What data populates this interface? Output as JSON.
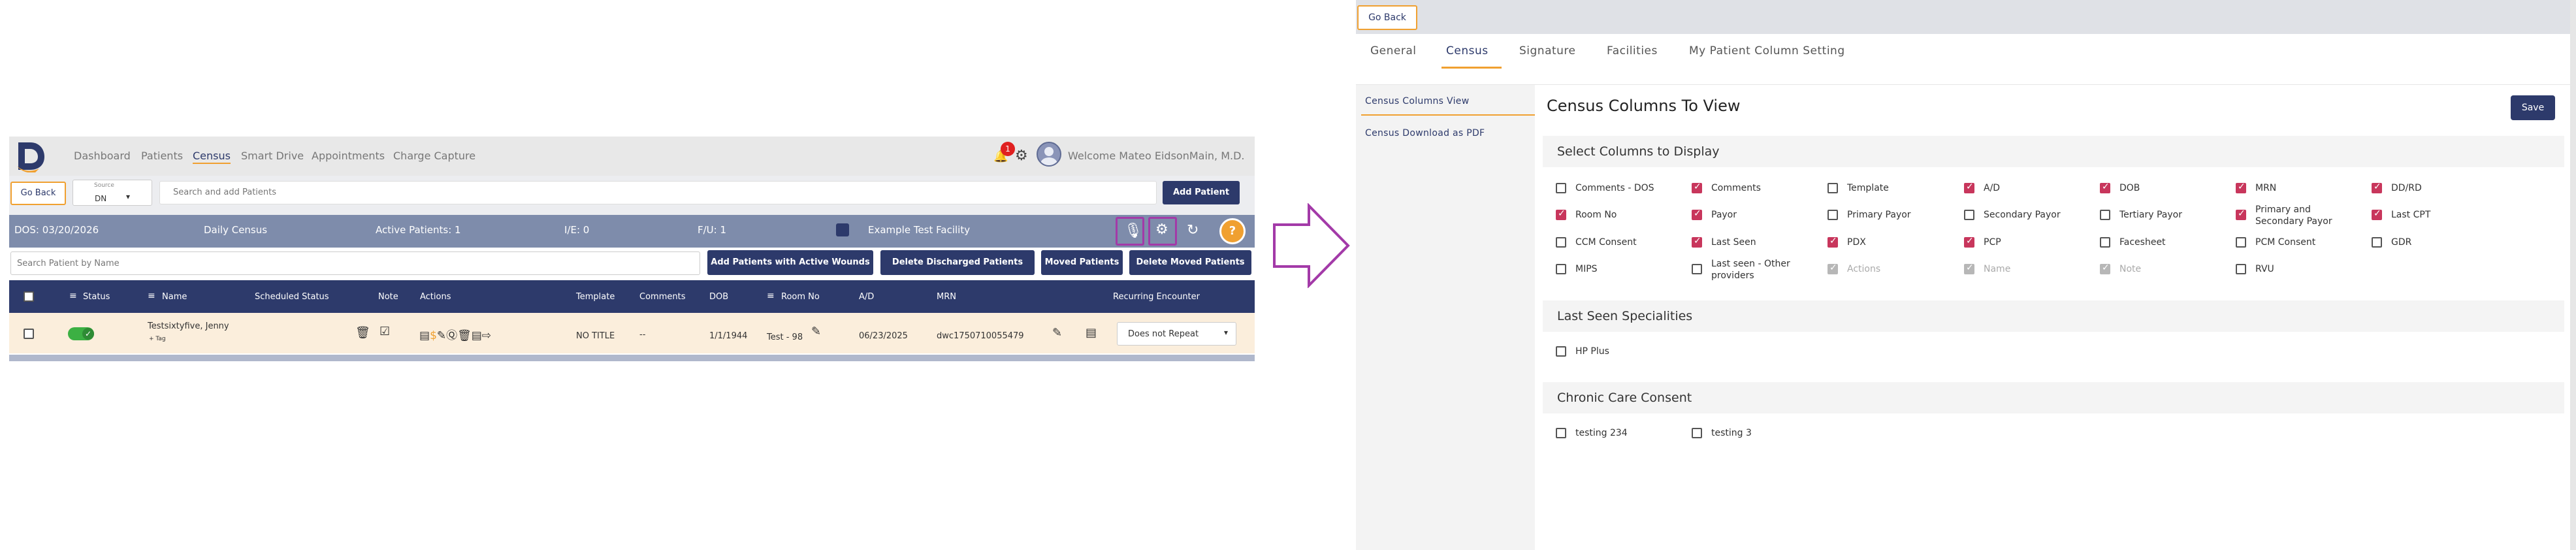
{
  "left": {
    "nav": {
      "links": [
        "Dashboard",
        "Patients",
        "Census",
        "Smart Drive",
        "Appointments",
        "Charge Capture"
      ],
      "active": "Census",
      "notification_count": "1",
      "welcome": "Welcome Mateo EidsonMain, M.D."
    },
    "toolbar": {
      "go_back": "Go Back",
      "source_label": "Source",
      "source_value": "DN",
      "search_placeholder": "Search and add Patients",
      "add_patient": "Add Patient"
    },
    "info": {
      "dos": "DOS: 03/20/2026",
      "census_type": "Daily Census",
      "active_patients": "Active Patients: 1",
      "ie": "I/E: 0",
      "fu": "F/U: 1",
      "facility": "Example Test Facility"
    },
    "actions": {
      "search_placeholder": "Search Patient by Name",
      "add_active_wounds": "Add Patients with Active Wounds",
      "delete_discharged": "Delete Discharged Patients",
      "moved_patients": "Moved Patients",
      "delete_moved": "Delete Moved Patients"
    },
    "table": {
      "headers": {
        "status": "Status",
        "name": "Name",
        "scheduled_status": "Scheduled Status",
        "note": "Note",
        "actions": "Actions",
        "template": "Template",
        "comments": "Comments",
        "dob": "DOB",
        "room_no": "Room No",
        "ad": "A/D",
        "mrn": "MRN",
        "recurring": "Recurring Encounter"
      },
      "row": {
        "name": "Testsixtyfive, Jenny",
        "tag": "+ Tag",
        "template": "NO TITLE",
        "comments": "--",
        "dob": "1/1/1944",
        "room": "Test - 98",
        "ad": "06/23/2025",
        "mrn": "dwc1750710055479",
        "recurring": "Does not Repeat"
      }
    }
  },
  "right": {
    "go_back": "Go Back",
    "tabs": [
      "General",
      "Census",
      "Signature",
      "Facilities",
      "My Patient Column Setting"
    ],
    "active_tab": "Census",
    "side_items": [
      "Census Columns View",
      "Census Download as PDF"
    ],
    "heading": "Census Columns To View",
    "save": "Save",
    "section_select": "Select Columns to Display",
    "columns": [
      {
        "label": "Comments - DOS",
        "state": "unchecked"
      },
      {
        "label": "Comments",
        "state": "checked"
      },
      {
        "label": "Template",
        "state": "unchecked"
      },
      {
        "label": "A/D",
        "state": "checked"
      },
      {
        "label": "DOB",
        "state": "checked"
      },
      {
        "label": "MRN",
        "state": "checked"
      },
      {
        "label": "DD/RD",
        "state": "checked"
      },
      {
        "label": "Room No",
        "state": "checked"
      },
      {
        "label": "Payor",
        "state": "checked"
      },
      {
        "label": "Primary Payor",
        "state": "unchecked"
      },
      {
        "label": "Secondary Payor",
        "state": "unchecked"
      },
      {
        "label": "Tertiary Payor",
        "state": "unchecked"
      },
      {
        "label": "Primary and Secondary Payor",
        "state": "checked"
      },
      {
        "label": "Last CPT",
        "state": "checked"
      },
      {
        "label": "CCM Consent",
        "state": "unchecked"
      },
      {
        "label": "Last Seen",
        "state": "checked"
      },
      {
        "label": "PDX",
        "state": "checked"
      },
      {
        "label": "PCP",
        "state": "checked"
      },
      {
        "label": "Facesheet",
        "state": "unchecked"
      },
      {
        "label": "PCM Consent",
        "state": "unchecked"
      },
      {
        "label": "GDR",
        "state": "unchecked"
      },
      {
        "label": "MIPS",
        "state": "unchecked"
      },
      {
        "label": "Last seen - Other providers",
        "state": "unchecked"
      },
      {
        "label": "Actions",
        "state": "disabled"
      },
      {
        "label": "Name",
        "state": "disabled"
      },
      {
        "label": "Note",
        "state": "disabled"
      },
      {
        "label": "RVU",
        "state": "unchecked"
      }
    ],
    "section_specialities": "Last Seen Specialities",
    "specialities": [
      {
        "label": "HP Plus",
        "state": "unchecked"
      }
    ],
    "section_chronic": "Chronic Care Consent",
    "chronic": [
      {
        "label": "testing 234",
        "state": "unchecked"
      },
      {
        "label": "testing 3",
        "state": "unchecked"
      }
    ]
  },
  "colors": {
    "navy": "#2d3a6b",
    "accent_orange": "#f0a030",
    "check_pink": "#c8365c",
    "highlight_purple": "#a33aa8",
    "info_bar": "#7e8cab"
  }
}
